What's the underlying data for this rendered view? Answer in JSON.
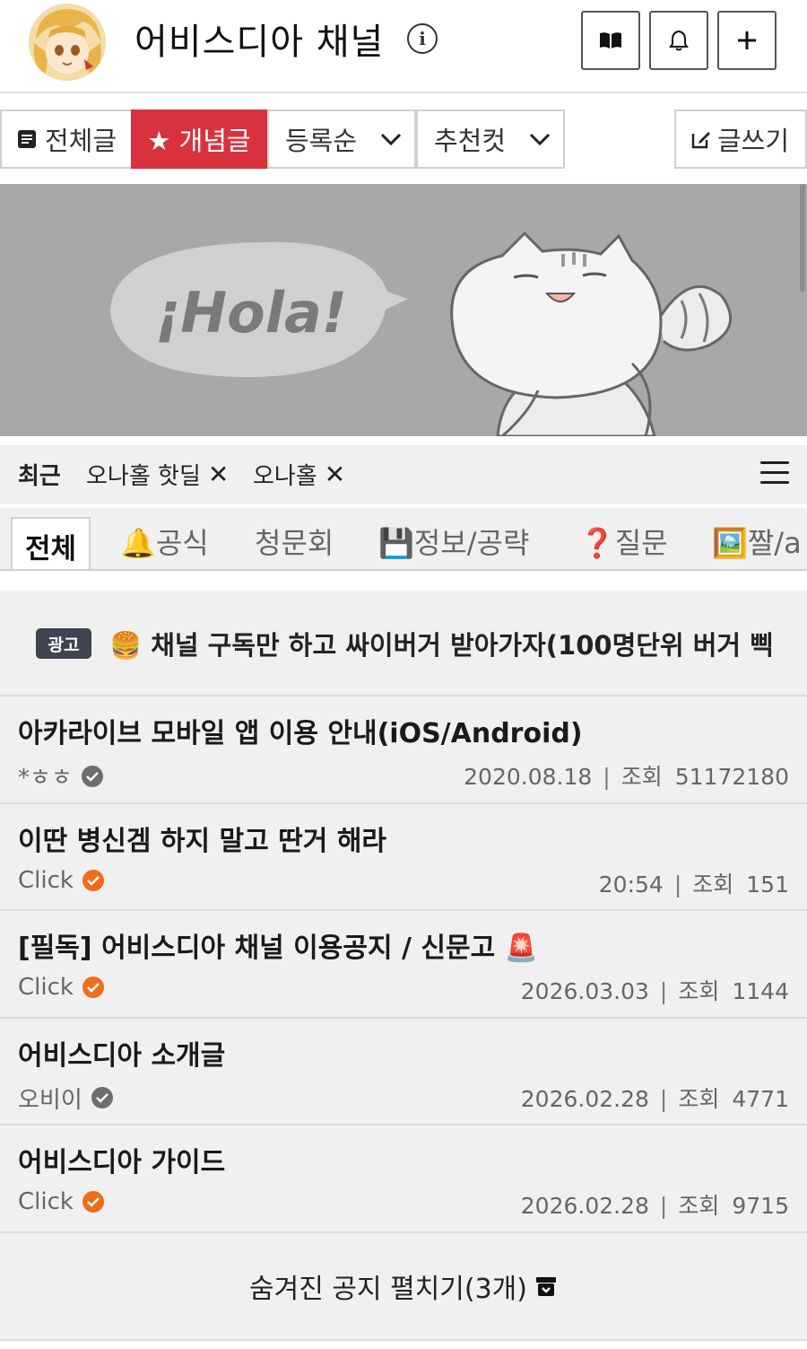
{
  "header": {
    "title": "어비스디아 채널",
    "info_icon": "info-icon",
    "buttons": [
      {
        "icon": "book-icon"
      },
      {
        "icon": "bell-icon"
      },
      {
        "icon": "plus-icon"
      }
    ]
  },
  "toolbar": {
    "all_posts": "전체글",
    "best_posts": "★ 개념글",
    "sort": "등록순",
    "recommend": "추천컷",
    "write": "글쓰기"
  },
  "banner": {
    "bubble_text": "¡Hola!"
  },
  "recent": {
    "title": "최근",
    "chips": [
      "오나홀 핫딜",
      "오나홀"
    ],
    "close_glyph": "✕"
  },
  "categories": [
    "전체",
    "🔔공식",
    "청문회",
    "💾정보/공략",
    "❓질문",
    "🖼️짤/a"
  ],
  "ad": {
    "badge": "광고",
    "text": "🍔 채널 구독만 하고 싸이버거 받아가자(100명단위 버거 삑"
  },
  "posts": [
    {
      "title": "아카라이브 모바일 앱 이용 안내(iOS/Android)",
      "author": "*ㅎㅎ",
      "badge": "grey",
      "date": "2020.08.18",
      "view_label": "조회",
      "views": "51172180"
    },
    {
      "title": "이딴 병신겜 하지 말고 딴거 해라",
      "author": "Click",
      "badge": "orange",
      "date": "20:54",
      "view_label": "조회",
      "views": "151"
    },
    {
      "title": "[필독] 어비스디아 채널 이용공지 / 신문고 🚨",
      "author": "Click",
      "badge": "orange",
      "date": "2026.03.03",
      "view_label": "조회",
      "views": "1144"
    },
    {
      "title": "어비스디아 소개글",
      "author": "오비이",
      "badge": "grey",
      "date": "2026.02.28",
      "view_label": "조회",
      "views": "4771"
    },
    {
      "title": "어비스디아 가이드",
      "author": "Click",
      "badge": "orange",
      "date": "2026.02.28",
      "view_label": "조회",
      "views": "9715"
    }
  ],
  "expand_label": "숨겨진 공지 펼치기(3개)",
  "colors": {
    "accent": "#d9323f",
    "verified_orange": "#ef6c1a",
    "verified_grey": "#6d6d6d",
    "banner_bg": "#a8a8a8"
  }
}
